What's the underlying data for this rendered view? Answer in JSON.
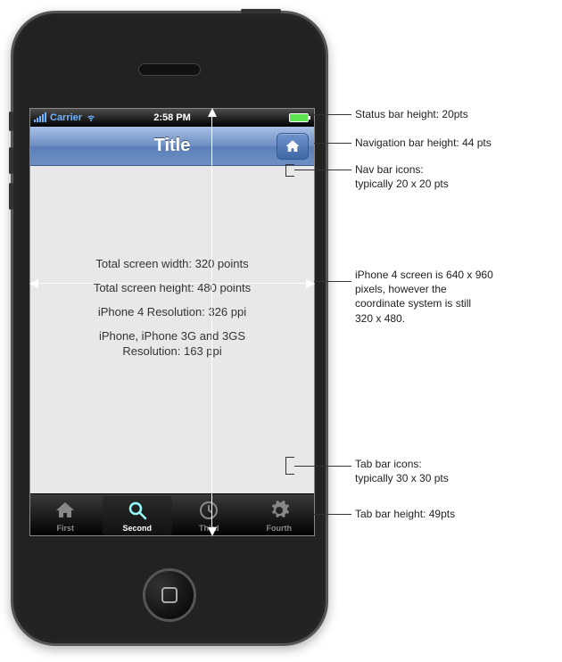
{
  "status_bar": {
    "carrier": "Carrier",
    "time": "2:58 PM"
  },
  "nav_bar": {
    "title": "Title"
  },
  "content": {
    "width_line": "Total screen width: 320 points",
    "height_line": "Total screen height: 480 points",
    "res4_line": "iPhone 4 Resolution: 326 ppi",
    "res_old_line1": "iPhone, iPhone 3G and 3GS",
    "res_old_line2": "Resolution: 163 ppi"
  },
  "tabs": [
    {
      "label": "First",
      "icon": "home-icon",
      "active": false
    },
    {
      "label": "Second",
      "icon": "search-icon",
      "active": true
    },
    {
      "label": "Third",
      "icon": "clock-icon",
      "active": false
    },
    {
      "label": "Fourth",
      "icon": "gear-icon",
      "active": false
    }
  ],
  "annotations": {
    "status_bar": "Status bar height: 20pts",
    "nav_bar": "Navigation bar height: 44 pts",
    "nav_icons_l1": "Nav bar icons:",
    "nav_icons_l2": "typically 20 x 20 pts",
    "screen_note_l1": "iPhone 4 screen is 640 x 960",
    "screen_note_l2": "pixels, however the",
    "screen_note_l3": "coordinate system is still",
    "screen_note_l4": "320 x 480.",
    "tab_icons_l1": "Tab bar icons:",
    "tab_icons_l2": "typically 30 x 30 pts",
    "tab_bar": "Tab bar height: 49pts"
  }
}
